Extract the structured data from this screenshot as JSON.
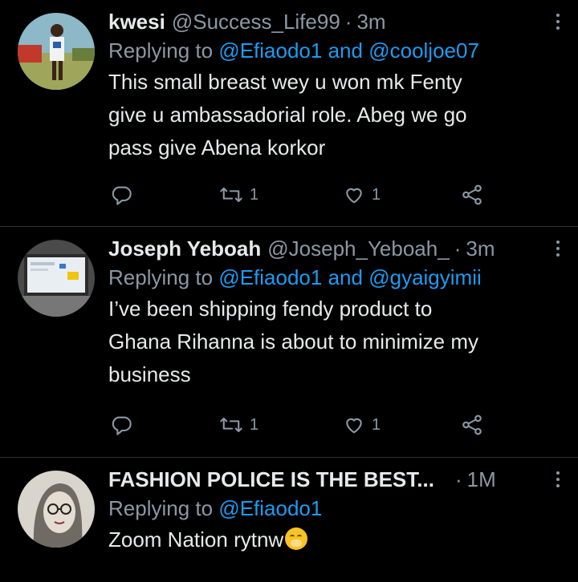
{
  "tweets": [
    {
      "name": "kwesi",
      "handle": "@Success_Life99",
      "separator": "·",
      "time": "3m",
      "reply_prefix": "Replying to",
      "mention1": "@Efiaodo1",
      "and": "and",
      "mention2": "@cooljoe07",
      "text": "This small breast wey u won mk Fenty\ngive u ambassadorial role. Abeg we go\npass give Abena korkor",
      "retweets": "1",
      "likes": "1"
    },
    {
      "name": "Joseph Yeboah",
      "handle": "@Joseph_Yeboah_",
      "separator": "·",
      "time": "3m",
      "reply_prefix": "Replying to",
      "mention1": "@Efiaodo1",
      "and": "and",
      "mention2": "@gyaigyimii",
      "text": "I’ve been shipping fendy product to\nGhana  Rihanna is about to minimize my\nbusiness",
      "retweets": "1",
      "likes": "1"
    },
    {
      "name": "FASHION POLICE IS THE BEST...",
      "separator": "·",
      "time": "1M",
      "reply_prefix": "Replying to",
      "mention1": "@Efiaodo1",
      "text": "Zoom Nation rytnw"
    }
  ],
  "icons": {
    "reply": "reply-icon",
    "retweet": "retweet-icon",
    "like": "heart-icon",
    "share": "share-icon",
    "more": "more-options-icon",
    "emoji": "hand-over-mouth-emoji"
  },
  "colors": {
    "background": "#000000",
    "text": "#e7e9ea",
    "secondary": "#8b98a5",
    "link": "#1d9bf0",
    "divider": "#2f3336"
  }
}
